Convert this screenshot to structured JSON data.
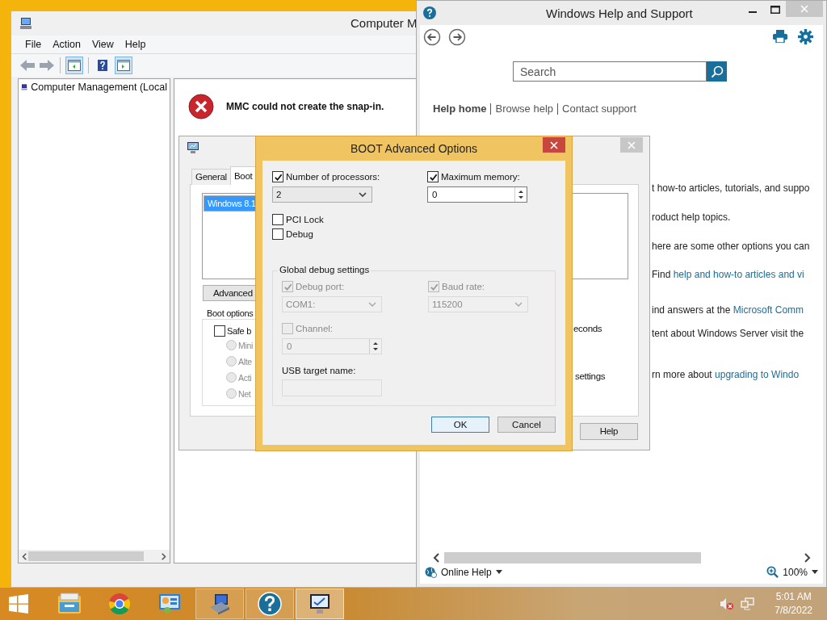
{
  "computer_management": {
    "title": "Computer M",
    "menu": [
      "File",
      "Action",
      "View",
      "Help"
    ],
    "toolbar": [
      {
        "kind": "back",
        "disabled": true
      },
      {
        "kind": "forward",
        "disabled": true
      },
      {
        "kind": "tree",
        "pressed": true
      },
      {
        "kind": "help",
        "pressed": false
      },
      {
        "kind": "actions",
        "pressed": true
      }
    ],
    "tree": [
      {
        "label": "Computer Management (Local",
        "selected": false
      }
    ],
    "error": {
      "message": "MMC could not create the snap-in."
    }
  },
  "help_window": {
    "title": "Windows Help and Support",
    "search": {
      "placeholder": "Search"
    },
    "nav": [
      {
        "label": "Help home",
        "selected": true
      },
      {
        "label": "Browse help",
        "selected": false
      },
      {
        "label": "Contact support",
        "selected": false
      }
    ],
    "lines": [
      {
        "parts": [
          {
            "text": "t how-to articles, tutorials, and suppo",
            "link": false
          }
        ]
      },
      {
        "parts": [
          {
            "text": "roduct help topics.",
            "link": false
          }
        ]
      },
      {
        "parts": [
          {
            "text": "here are some other options you can",
            "link": false
          }
        ]
      },
      {
        "parts": [
          {
            "text": "Find ",
            "link": false
          },
          {
            "text": "help and how-to articles and vi",
            "link": true
          }
        ]
      },
      {
        "parts": [
          {
            "text": "ind answers at the ",
            "link": false
          },
          {
            "text": "Microsoft Comm",
            "link": true
          }
        ]
      },
      {
        "parts": [
          {
            "text": "tent about Windows Server visit the",
            "link": false
          }
        ]
      },
      {
        "parts": [
          {
            "text": "rn more about ",
            "link": false
          },
          {
            "text": "upgrading to Windo",
            "link": true
          }
        ]
      }
    ],
    "footer": {
      "online": "Online Help",
      "zoom": "100%"
    }
  },
  "system_configuration": {
    "tabs": [
      {
        "label": "General",
        "selected": false
      },
      {
        "label": "Boot",
        "selected": true
      }
    ],
    "boot_entries": [
      {
        "label": "Windows 8.1",
        "selected": true
      }
    ],
    "advanced_button": "Advanced",
    "boot_options": {
      "title": "Boot options",
      "safe_boot": {
        "label": "Safe b",
        "checked": false
      },
      "modes": [
        {
          "label": "Mini",
          "selected": false,
          "disabled": true
        },
        {
          "label": "Alte",
          "selected": false,
          "disabled": true
        },
        {
          "label": "Acti",
          "selected": false,
          "disabled": true
        },
        {
          "label": "Net",
          "selected": false,
          "disabled": true
        }
      ]
    },
    "timeout_text": "econds",
    "permanent_text": "settings",
    "help_button": "Help"
  },
  "boot_advanced": {
    "title": "BOOT Advanced Options",
    "processors": {
      "label": "Number of processors:",
      "checked": true,
      "value": "2"
    },
    "max_memory": {
      "label": "Maximum memory:",
      "checked": true,
      "value": "0"
    },
    "pci_lock": {
      "label": "PCI Lock",
      "checked": false
    },
    "debug": {
      "label": "Debug",
      "checked": false
    },
    "debug_settings": {
      "title": "Global debug settings",
      "debug_port": {
        "label": "Debug port:",
        "checked": true,
        "disabled": true,
        "value": "COM1:"
      },
      "baud_rate": {
        "label": "Baud rate:",
        "checked": true,
        "disabled": true,
        "value": "115200"
      },
      "channel": {
        "label": "Channel:",
        "checked": false,
        "disabled": true,
        "value": "0"
      },
      "usb_target": {
        "label": "USB target name:",
        "disabled": true
      }
    },
    "buttons": [
      {
        "label": "OK",
        "default": true
      },
      {
        "label": "Cancel",
        "default": false
      }
    ]
  },
  "taskbar": {
    "items": [
      {
        "kind": "start",
        "running": false,
        "active": false
      },
      {
        "kind": "explorer",
        "running": false,
        "active": false
      },
      {
        "kind": "chrome",
        "running": false,
        "active": false
      },
      {
        "kind": "control-panel",
        "running": false,
        "active": false
      },
      {
        "kind": "computer-management",
        "running": true,
        "active": false
      },
      {
        "kind": "help",
        "running": true,
        "active": false
      },
      {
        "kind": "msconfig",
        "running": true,
        "active": true
      }
    ],
    "time": "5:01 AM",
    "date": "7/8/2022"
  }
}
